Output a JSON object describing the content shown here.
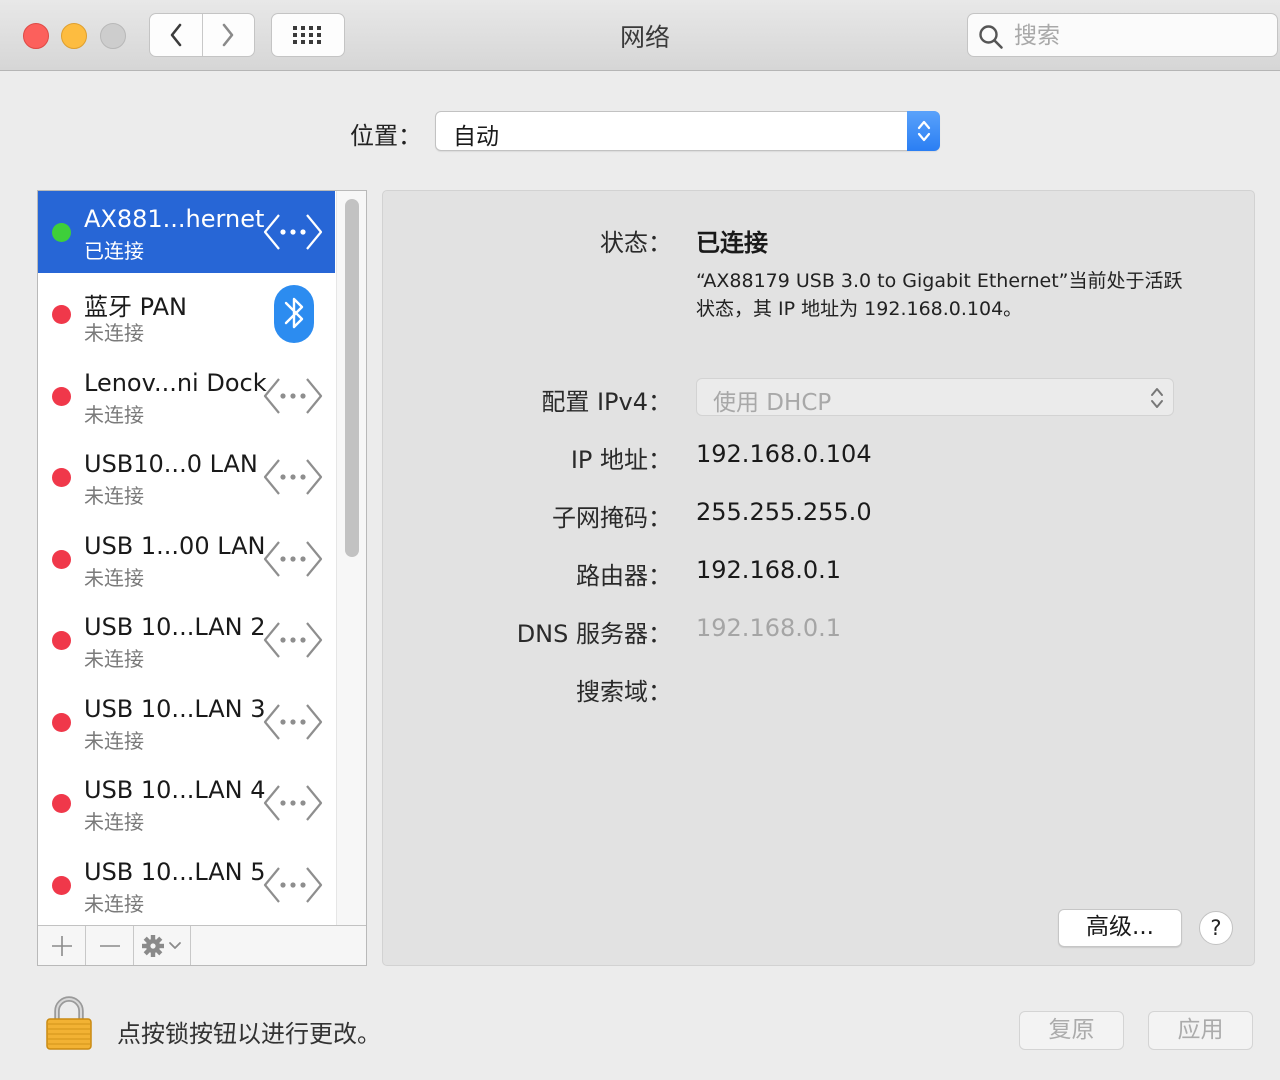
{
  "window": {
    "title": "网络"
  },
  "search": {
    "placeholder": "搜索",
    "value": ""
  },
  "location": {
    "label": "位置：",
    "value": "自动"
  },
  "services": [
    {
      "name": "AX881...hernet",
      "status": "已连接",
      "connected": true,
      "selected": true,
      "icon": "ethernet-icon"
    },
    {
      "name": "蓝牙 PAN",
      "status": "未连接",
      "connected": false,
      "selected": false,
      "icon": "bluetooth-icon"
    },
    {
      "name": "Lenov...ni Dock",
      "status": "未连接",
      "connected": false,
      "selected": false,
      "icon": "ethernet-icon"
    },
    {
      "name": "USB10...0 LAN",
      "status": "未连接",
      "connected": false,
      "selected": false,
      "icon": "ethernet-icon"
    },
    {
      "name": "USB 1...00 LAN",
      "status": "未连接",
      "connected": false,
      "selected": false,
      "icon": "ethernet-icon"
    },
    {
      "name": "USB 10...LAN 2",
      "status": "未连接",
      "connected": false,
      "selected": false,
      "icon": "ethernet-icon"
    },
    {
      "name": "USB 10...LAN 3",
      "status": "未连接",
      "connected": false,
      "selected": false,
      "icon": "ethernet-icon"
    },
    {
      "name": "USB 10...LAN 4",
      "status": "未连接",
      "connected": false,
      "selected": false,
      "icon": "ethernet-icon"
    },
    {
      "name": "USB 10...LAN 5",
      "status": "未连接",
      "connected": false,
      "selected": false,
      "icon": "ethernet-icon"
    }
  ],
  "detail": {
    "status_label": "状态：",
    "status_value": "已连接",
    "description": "“AX88179 USB 3.0 to Gigabit Ethernet”当前处于活跃状态，其 IP 地址为 192.168.0.104。",
    "ipv4_label": "配置 IPv4：",
    "ipv4_value": "使用 DHCP",
    "ip_label": "IP 地址：",
    "ip_value": "192.168.0.104",
    "subnet_label": "子网掩码：",
    "subnet_value": "255.255.255.0",
    "router_label": "路由器：",
    "router_value": "192.168.0.1",
    "dns_label": "DNS 服务器：",
    "dns_value": "192.168.0.1",
    "search_domain_label": "搜索域：",
    "search_domain_value": "",
    "advanced_button": "高级...",
    "help_button": "?"
  },
  "footer": {
    "lock_text": "点按锁按钮以进行更改。",
    "revert_button": "复原",
    "apply_button": "应用"
  },
  "colors": {
    "selection": "#2766d6",
    "connected": "#3ecf3a",
    "disconnected": "#f0384a",
    "accent": "#2a7ef3"
  }
}
